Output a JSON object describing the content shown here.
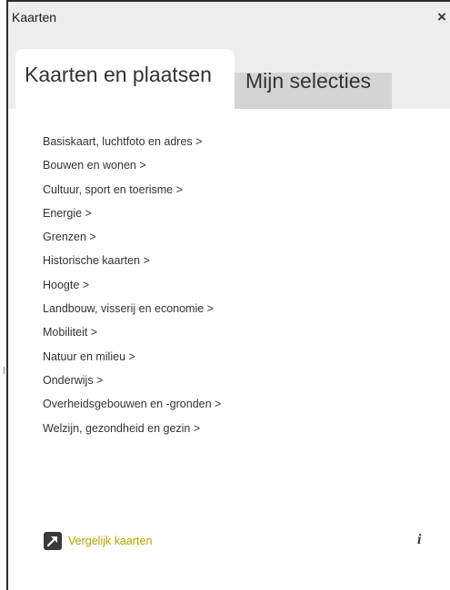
{
  "panel": {
    "title": "Kaarten",
    "close_symbol": "×"
  },
  "tabs": [
    {
      "label": "Kaarten en plaatsen",
      "active": true
    },
    {
      "label": "Mijn selecties",
      "active": false
    }
  ],
  "categories": [
    "Basiskaart, luchtfoto en adres >",
    "Bouwen en wonen >",
    "Cultuur, sport en toerisme >",
    "Energie >",
    "Grenzen >",
    "Historische kaarten >",
    "Hoogte >",
    "Landbouw, visserij en economie >",
    "Mobiliteit >",
    "Natuur en milieu >",
    "Onderwijs >",
    "Overheidsgebouwen en -gronden >",
    "Welzijn, gezondheid en gezin >"
  ],
  "compare": {
    "label": "Vergelijk kaarten",
    "icon": "arrow-up-right-icon",
    "color": "#b5a100"
  },
  "info": {
    "symbol": "i",
    "icon": "info-icon"
  }
}
